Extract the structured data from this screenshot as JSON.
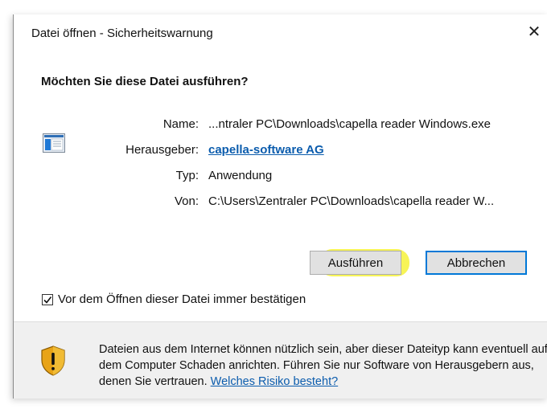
{
  "window": {
    "title": "Datei öffnen - Sicherheitswarnung",
    "close_glyph": "✕"
  },
  "heading": "Möchten Sie diese Datei ausführen?",
  "details": {
    "name_label": "Name:",
    "name_value": "...ntraler PC\\Downloads\\capella reader Windows.exe",
    "publisher_label": "Herausgeber:",
    "publisher_value": "capella-software AG",
    "type_label": "Typ:",
    "type_value": "Anwendung",
    "from_label": "Von:",
    "from_value": "C:\\Users\\Zentraler PC\\Downloads\\capella reader W..."
  },
  "buttons": {
    "run": "Ausführen",
    "cancel": "Abbrechen"
  },
  "checkbox": {
    "label": "Vor dem Öffnen dieser Datei immer bestätigen",
    "checked": true
  },
  "warning": {
    "text": "Dateien aus dem Internet können nützlich sein, aber dieser Dateityp kann eventuell auf dem Computer Schaden anrichten. Führen Sie nur Software von Herausgebern aus, denen Sie vertrauen.",
    "link": "Welches Risiko besteht?"
  },
  "icons": {
    "file": "exe-file-icon",
    "shield": "security-shield-icon"
  },
  "colors": {
    "accent": "#0078d7",
    "link": "#0b5cad",
    "highlight": "#f6f23a"
  }
}
